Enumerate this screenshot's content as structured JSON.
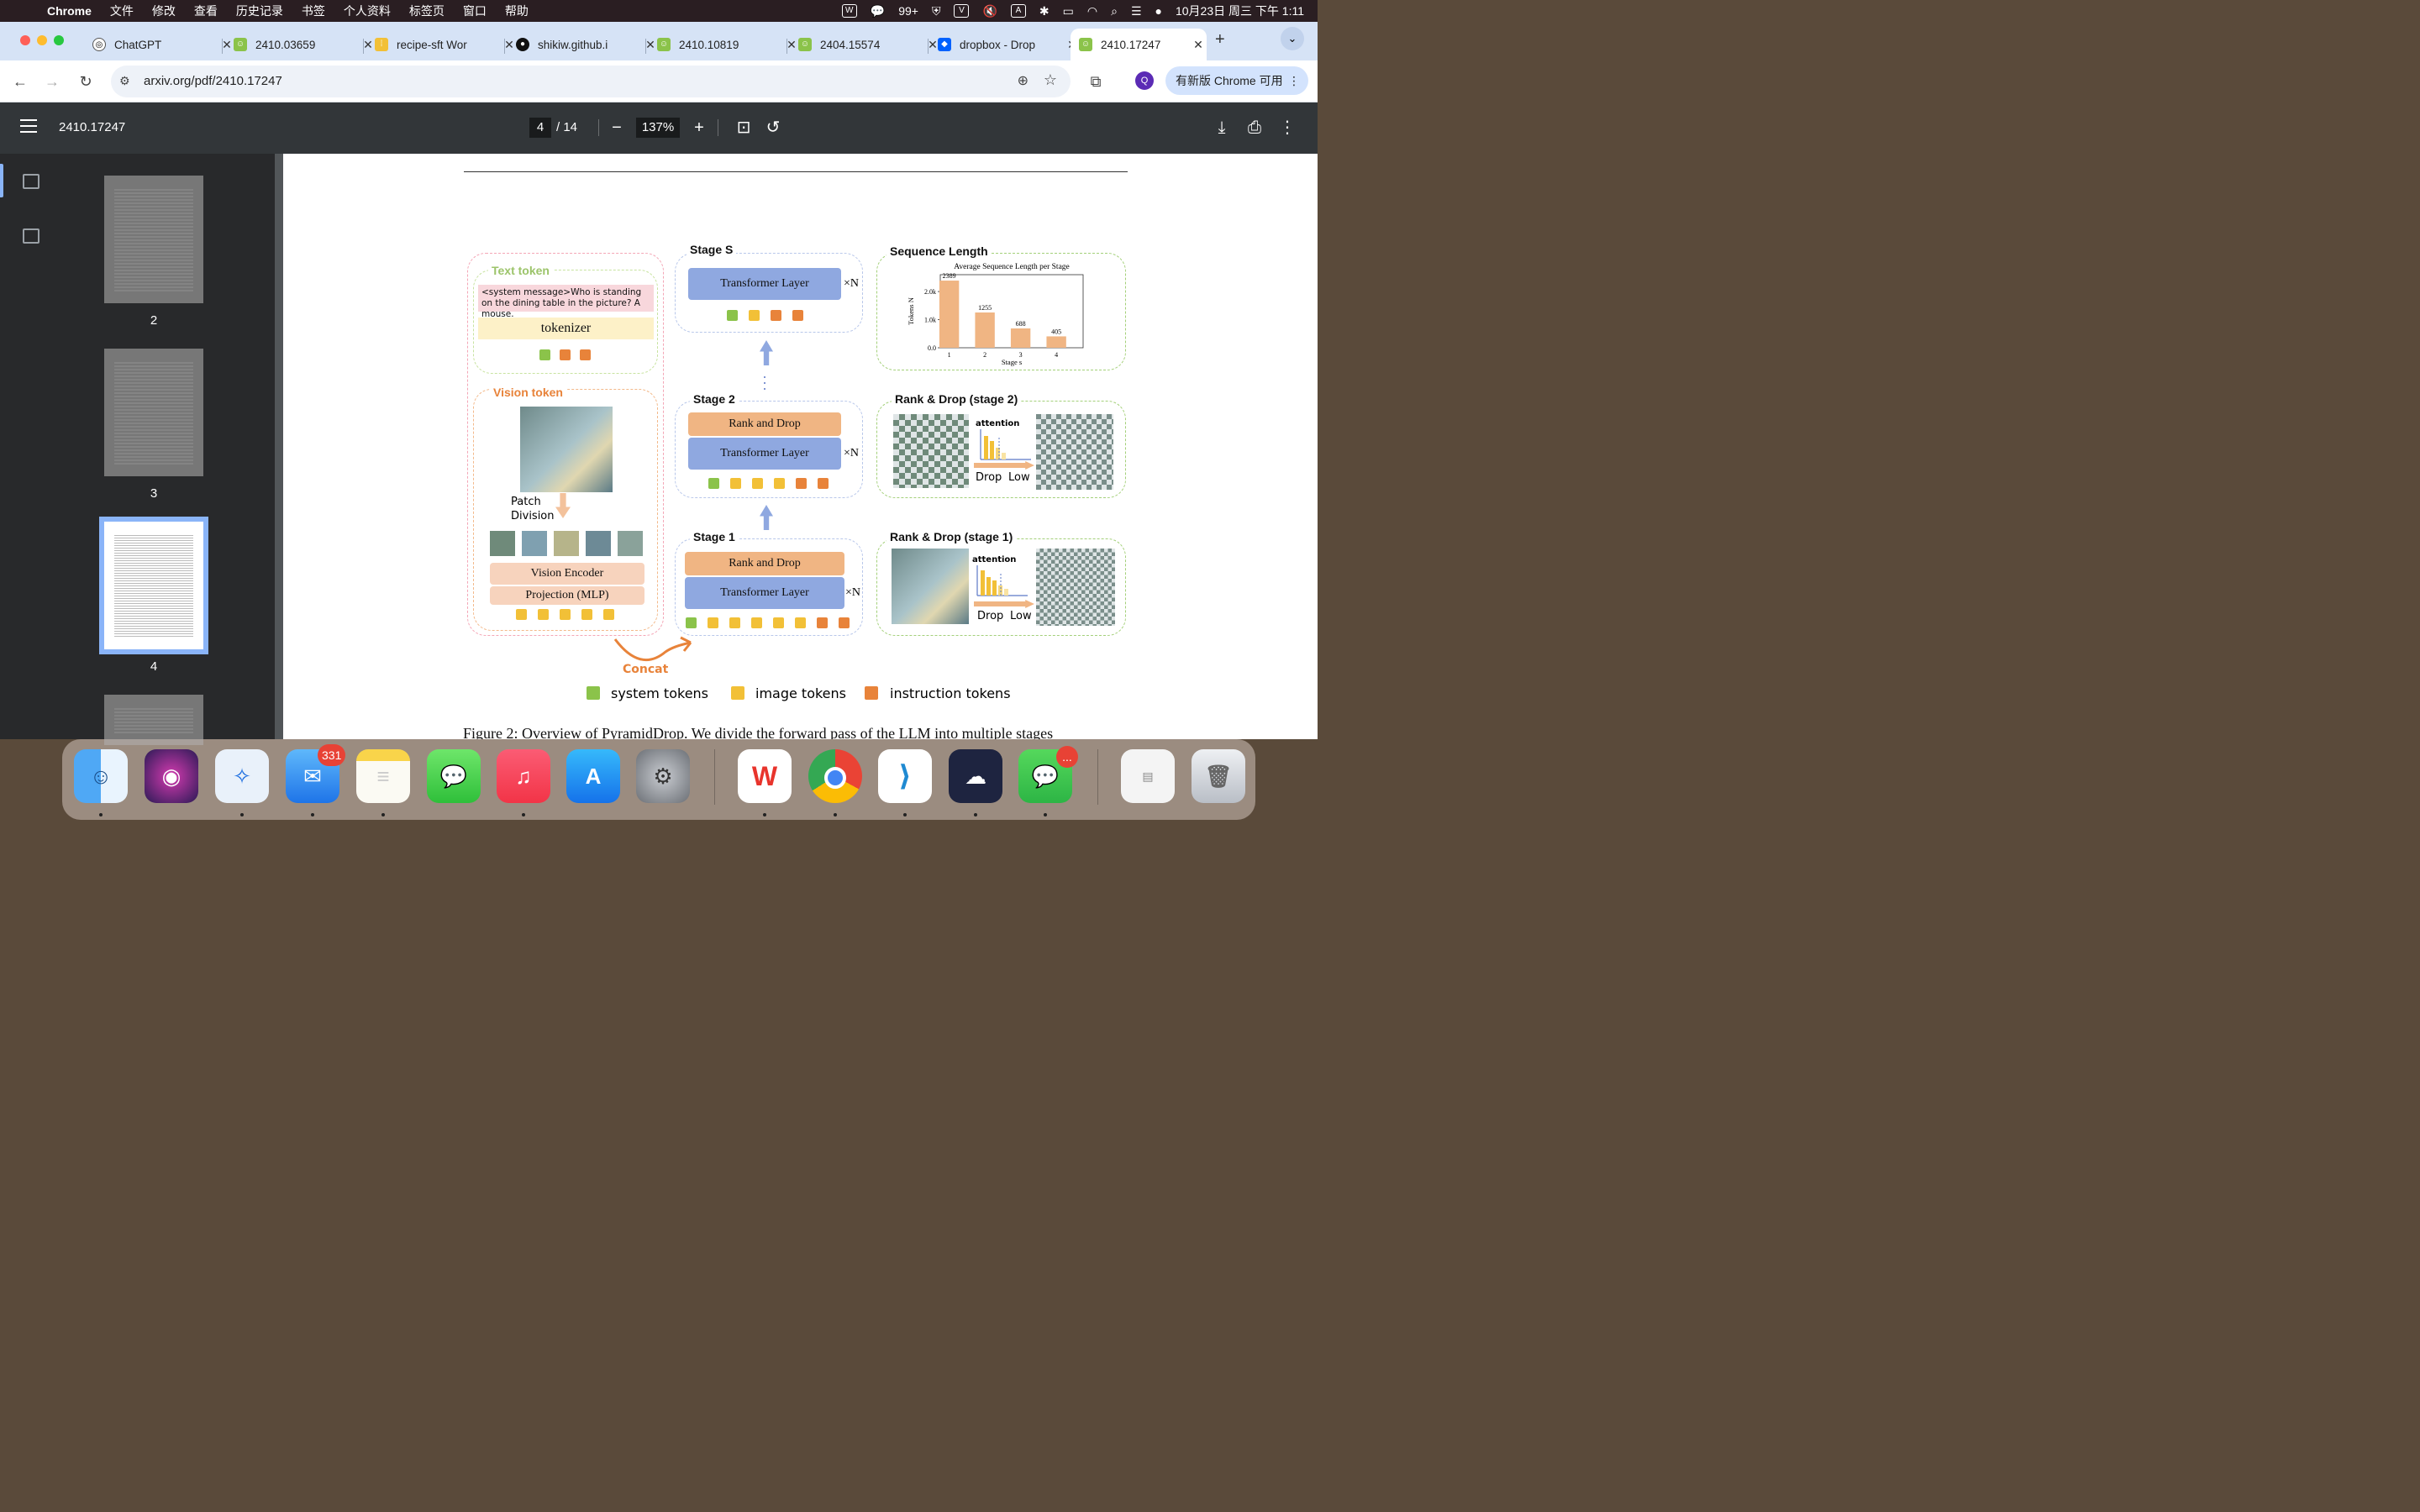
{
  "menubar": {
    "app": "Chrome",
    "items": [
      "文件",
      "修改",
      "查看",
      "历史记录",
      "书签",
      "个人资料",
      "标签页",
      "窗口",
      "帮助"
    ],
    "wechat_count": "99+",
    "datetime": "10月23日 周三 下午 1:11"
  },
  "tabs": [
    {
      "label": "ChatGPT"
    },
    {
      "label": "2410.03659"
    },
    {
      "label": "recipe-sft Wor"
    },
    {
      "label": "shikiw.github.i"
    },
    {
      "label": "2410.10819"
    },
    {
      "label": "2404.15574"
    },
    {
      "label": "dropbox - Drop"
    },
    {
      "label": "2410.17247"
    }
  ],
  "toolbar": {
    "url": "arxiv.org/pdf/2410.17247",
    "avatar_letter": "Q",
    "update_label": "有新版 Chrome 可用"
  },
  "pdf": {
    "title": "2410.17247",
    "page": "4",
    "total": "/ 14",
    "zoom": "137%",
    "thumbnails": [
      "2",
      "3",
      "4"
    ]
  },
  "figure": {
    "text_token_label": "Text token",
    "prompt": "<system message>Who is standing on the dining table in the picture? A mouse.",
    "tokenizer": "tokenizer",
    "vision_token_label": "Vision token",
    "patch_division": "Patch Division",
    "vision_encoder": "Vision Encoder",
    "projection": "Projection (MLP)",
    "concat": "Concat",
    "stage_s": "Stage S",
    "stage_2": "Stage 2",
    "stage_1": "Stage 1",
    "transformer_layer": "Transformer Layer",
    "rank_and_drop": "Rank and Drop",
    "xn": "×N",
    "seq_len_label": "Sequence Length",
    "rank_drop_2": "Rank & Drop (stage 2)",
    "rank_drop_1": "Rank & Drop (stage 1)",
    "attention": "attention",
    "drop": "Drop",
    "low": "Low",
    "legend": [
      "system tokens",
      "image tokens",
      "instruction tokens"
    ],
    "caption": "Figure 2: Overview of PyramidDrop. We divide the forward pass of the LLM into multiple stages"
  },
  "chart_data": {
    "type": "bar",
    "title": "Average Sequence Length per Stage",
    "xlabel": "Stage s",
    "ylabel": "Tokens N",
    "categories": [
      "1",
      "2",
      "3",
      "4"
    ],
    "values": [
      2389,
      1255,
      688,
      405
    ],
    "yticks": [
      "0.0",
      "1.0k",
      "2.0k"
    ],
    "ylim": [
      0,
      2600
    ]
  },
  "colors": {
    "system": "#8bc34a",
    "image": "#f2c037",
    "instruction": "#e8833a",
    "bar": "#f0b583"
  },
  "dock": {
    "mail_badge": "331",
    "wechat_badge": "..."
  }
}
